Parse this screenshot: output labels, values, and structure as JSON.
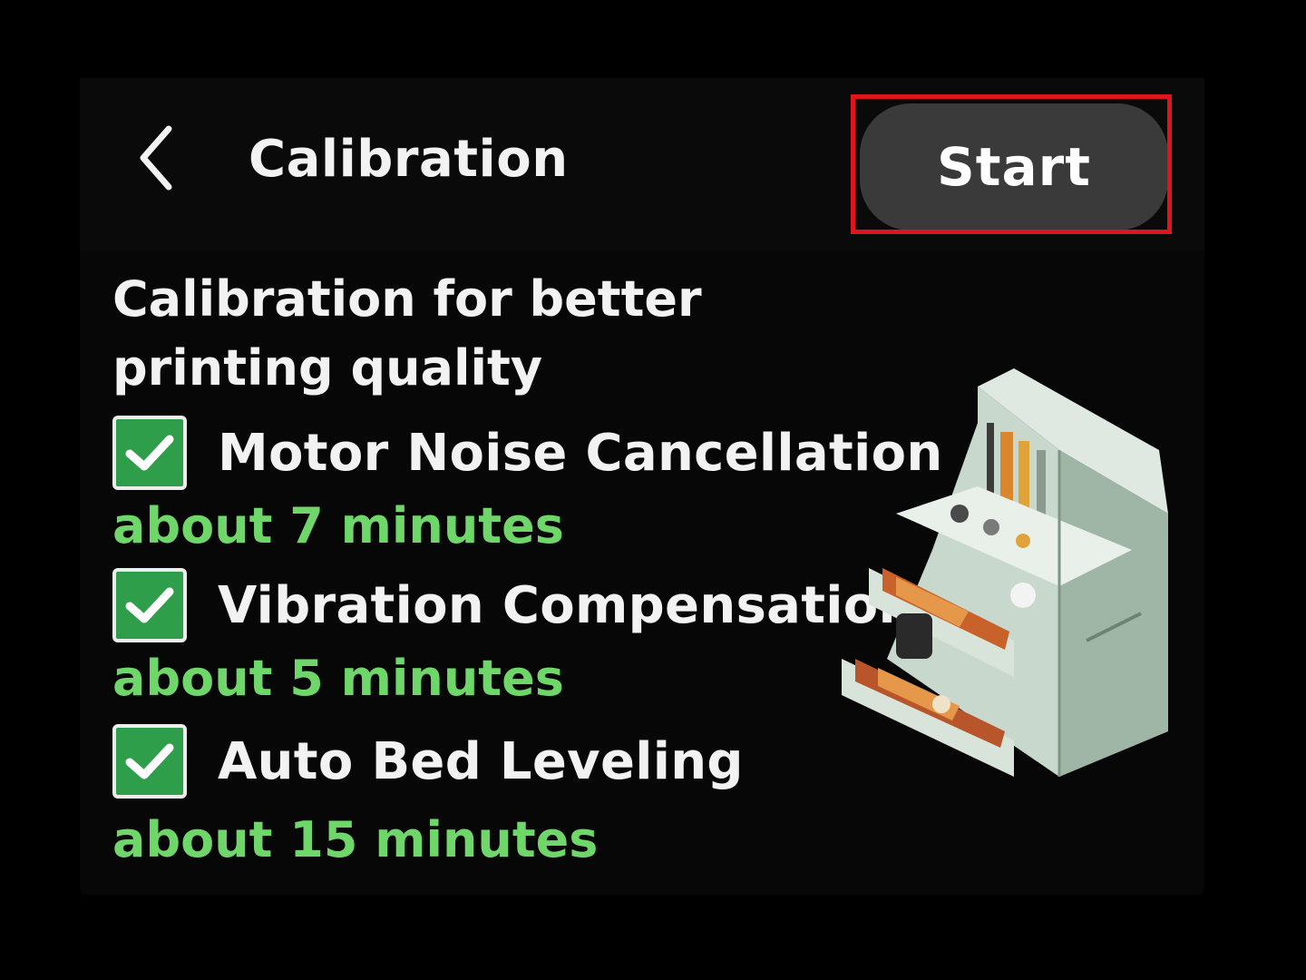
{
  "header": {
    "title": "Calibration",
    "start_label": "Start"
  },
  "description": {
    "line1": "Calibration for better",
    "line2": "printing quality"
  },
  "options": [
    {
      "label": "Motor Noise Cancellation",
      "duration": "about 7 minutes",
      "checked": true
    },
    {
      "label": "Vibration Compensation",
      "duration": "about 5 minutes",
      "checked": true
    },
    {
      "label": "Auto Bed Leveling",
      "duration": "about 15 minutes",
      "checked": true
    }
  ],
  "icons": {
    "back": "chevron-left-icon",
    "check": "checkmark-icon",
    "illustration": "printer-calibration-illustration"
  },
  "colors": {
    "checkbox_fill": "#2e9e4a",
    "duration_text": "#6fd66a",
    "start_button": "#3a3a3a",
    "highlight_border": "#e0141c"
  }
}
